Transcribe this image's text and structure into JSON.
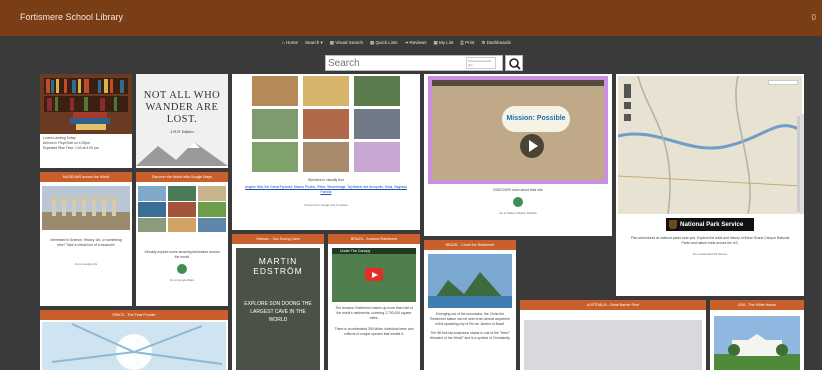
{
  "header": {
    "title": "Fortismere School Library",
    "corner": "0"
  },
  "nav": {
    "items": [
      "⌂ Home",
      "Search ▾",
      "▦ Visual Search",
      "▦ Quick Lists",
      "⇥ Reviews",
      "▦ My List",
      "⎙ Print",
      "⚙ Dashboards"
    ]
  },
  "search": {
    "placeholder": "Search",
    "tip": "Advanced search tips"
  },
  "cards": {
    "reading": {
      "lines": [
        "Lorem Lending Today",
        "Arrives in Floyd Bell on 4.00pm",
        "Expected Rise Time: 1:00 at 4.00 pm"
      ]
    },
    "quote": {
      "text": "NOT ALL WHO WANDER ARE LOST.",
      "author": "J.R.R Tolkien"
    },
    "wonders": {
      "caption": "Wonders in visually tour",
      "links": "Angkor Wat, the Great Pyramid, Machu Picchu, Petra, Stonehenge, Taj Mahal, the Acropolis, Moai, Sagrada Familia",
      "credit": "Scenes from Google Arts & Culture"
    },
    "mission": {
      "video_title": "Mission: Possible",
      "caption": "DISCOVER more about their site",
      "credit": "Go to Tekken Mission Website"
    },
    "map": {
      "label": "National Park Service"
    },
    "map_text": {
      "body": "Plan adventures at national parks near you. Explore the trails and history of these Grand Canyon National Parks and nature trails across the US.",
      "credit": "Go to National Park Service"
    },
    "museum": {
      "head": "MUSEUMS across the World",
      "body": "Interested in Science, History, Art, or something else? Take a virtual tour of a museum!",
      "credit": "Go to Google Arts"
    },
    "globe": {
      "head": "Discover the World with Google Maps",
      "body": "Virtually explore some amazing landmarks around the world!",
      "credit": "Go to Google Maps"
    },
    "caves": {
      "head": "Vietnam - Son Doong Cave",
      "book_author": "MARTIN EDSTRÖM",
      "book_title": "EXPLORE SON DOONG THE LARGEST CAVE IN THE WORLD"
    },
    "rainforest": {
      "head": "BRAZIL - Amazon Rainforest",
      "video_title": "Under The Canopy",
      "body": "The Amazon Rainforest makes up more than half of the world's rainforests, covering 2,700,000 square miles.",
      "body2": "There is an estimated 390 billion individual trees and millions of unique species that inhabit it."
    },
    "redeemer": {
      "head": "BRAZIL - Christ the Redeemer",
      "body": "Emerging out of the mountains, the Christ the Redeemer statue can be seen from almost anywhere in the sprawling city of Rio de Janeiro in Brazil.",
      "body2": "The 98 foot tall soapstone statue is one of the \"New7 Wonders of the World\" and is a symbol of Christianity."
    },
    "space": {
      "head": "SPACE - The Final Frontier"
    },
    "reef": {
      "head": "AUSTRALIA - Great Barrier Reef"
    },
    "whitehouse": {
      "head": "USA - The White House"
    }
  }
}
